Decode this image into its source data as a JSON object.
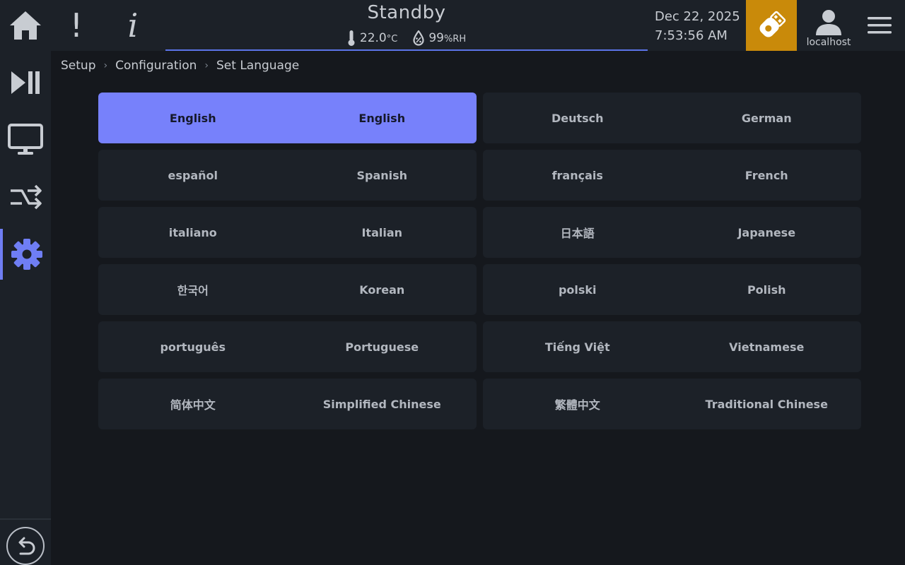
{
  "header": {
    "state": "Standby",
    "temperature": "22.0",
    "temperature_unit": "°C",
    "humidity": "99",
    "humidity_unit": "%RH",
    "date": "Dec 22, 2025",
    "time": "7:53:56 AM",
    "user": "localhost",
    "alert_glyph": "!",
    "info_glyph": "i",
    "usb_color": "#c98a0a",
    "accent_color": "#6f7ef4"
  },
  "sidebar": {
    "items": [
      {
        "icon": "play-pause-icon"
      },
      {
        "icon": "monitor-icon"
      },
      {
        "icon": "shuffle-icon"
      },
      {
        "icon": "gear-icon",
        "active": true
      }
    ]
  },
  "breadcrumb": [
    "Setup",
    "Configuration",
    "Set Language"
  ],
  "languages": [
    {
      "native": "English",
      "english": "English",
      "selected": true
    },
    {
      "native": "Deutsch",
      "english": "German"
    },
    {
      "native": "español",
      "english": "Spanish"
    },
    {
      "native": "français",
      "english": "French"
    },
    {
      "native": "italiano",
      "english": "Italian"
    },
    {
      "native": "日本語",
      "english": "Japanese"
    },
    {
      "native": "한국어",
      "english": "Korean"
    },
    {
      "native": "polski",
      "english": "Polish"
    },
    {
      "native": "português",
      "english": "Portuguese"
    },
    {
      "native": "Tiếng Việt",
      "english": "Vietnamese"
    },
    {
      "native": "简体中文",
      "english": "Simplified Chinese"
    },
    {
      "native": "繁體中文",
      "english": "Traditional Chinese"
    }
  ]
}
